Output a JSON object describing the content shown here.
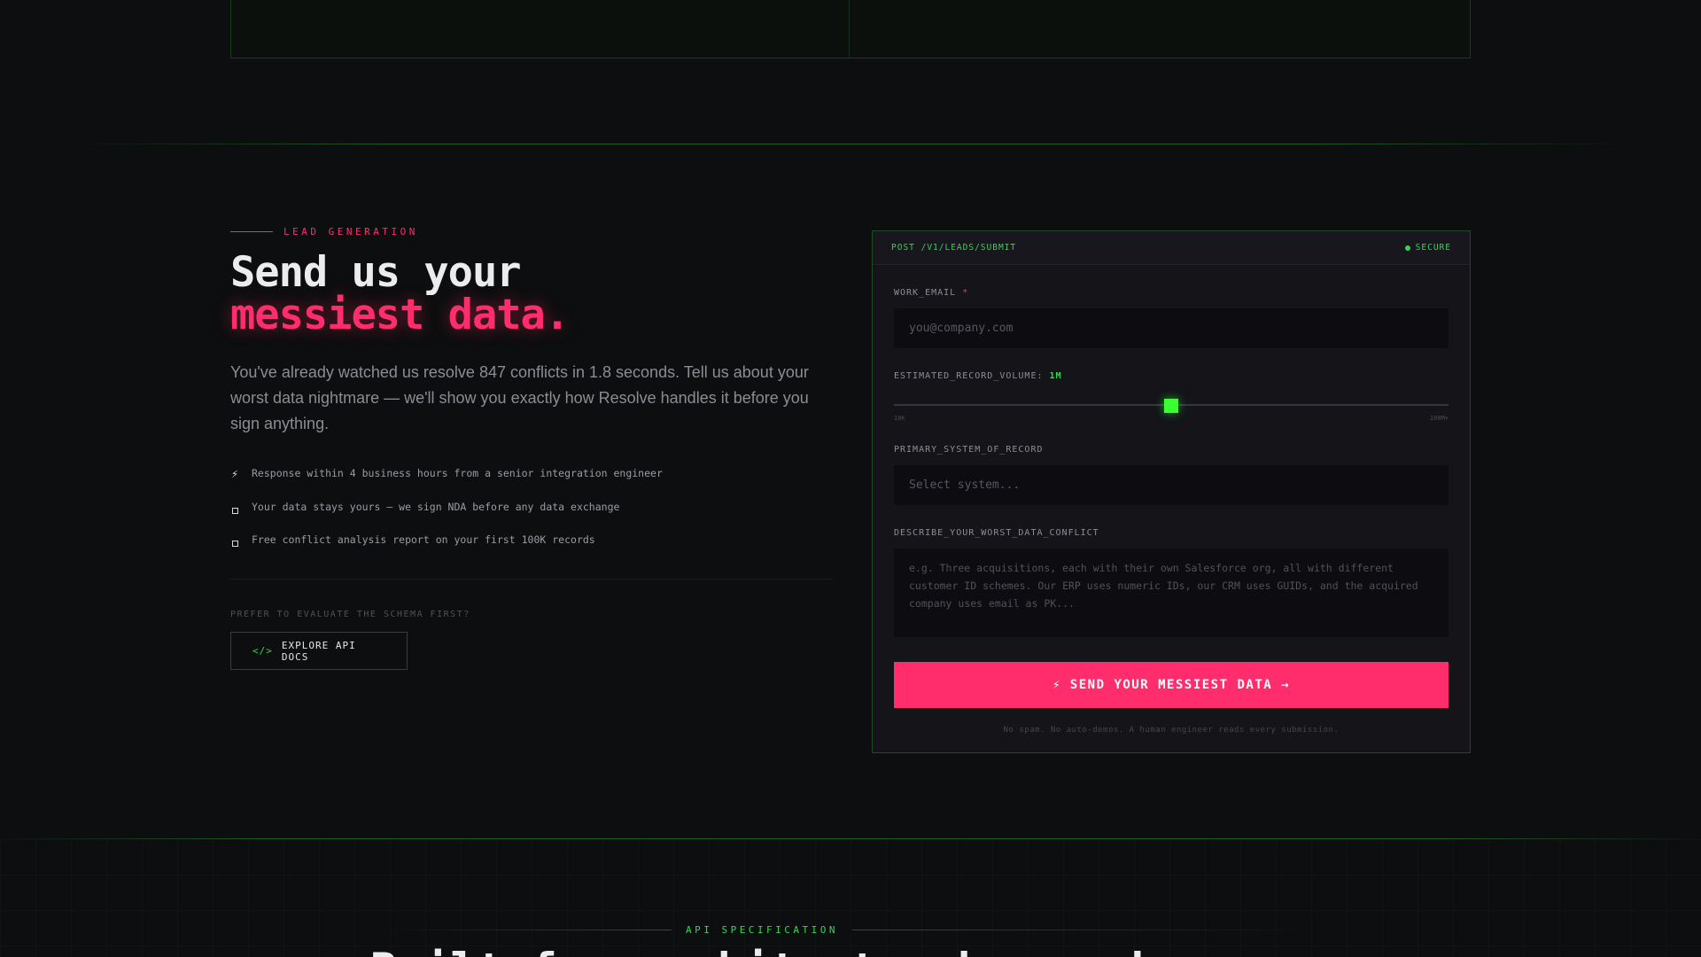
{
  "lead": {
    "eyebrow": "LEAD GENERATION",
    "title_line1": "Send us your",
    "title_line2": "messiest data.",
    "lede": "You've already watched us resolve 847 conflicts in 1.8 seconds. Tell us about your worst data nightmare — we'll show you exactly how Resolve handles it before you sign anything.",
    "bullets": [
      {
        "icon": "lightning-icon",
        "text": "Response within 4 business hours from a senior integration engineer"
      },
      {
        "icon": "square-icon",
        "text": "Your data stays yours — we sign NDA before any data exchange"
      },
      {
        "icon": "square-icon",
        "text": "Free conflict analysis report on your first 100K records"
      }
    ],
    "prefer_text": "PREFER TO EVALUATE THE SCHEMA FIRST?",
    "api_button": {
      "code": "</>",
      "label": "EXPLORE API DOCS"
    }
  },
  "form": {
    "endpoint": "POST /V1/LEADS/SUBMIT",
    "secure_label": "SECURE",
    "email_label": "WORK_EMAIL",
    "required_mark": "*",
    "email_placeholder": "you@company.com",
    "volume_label": "ESTIMATED_RECORD_VOLUME:",
    "volume_value": "1M",
    "volume_fraction": 0.5,
    "volume_min": "10K",
    "volume_max": "100M+",
    "system_label": "PRIMARY_SYSTEM_OF_RECORD",
    "system_placeholder": "Select system...",
    "conflict_label": "DESCRIBE_YOUR_WORST_DATA_CONFLICT",
    "conflict_placeholder": "e.g. Three acquisitions, each with their own Salesforce org, all with different customer ID schemes. Our ERP uses numeric IDs, our CRM uses GUIDs, and the acquired company uses email as PK...",
    "submit_label": "⚡ SEND YOUR MESSIEST DATA →",
    "note": "No spam. No auto-demos. A human engineer reads every submission."
  },
  "next_section": {
    "eyebrow": "API SPECIFICATION",
    "title": "Built for architects who read specs."
  },
  "colors": {
    "accent_pink": "#ff2d6b",
    "accent_green": "#39d353",
    "background": "#0d0e0f"
  }
}
